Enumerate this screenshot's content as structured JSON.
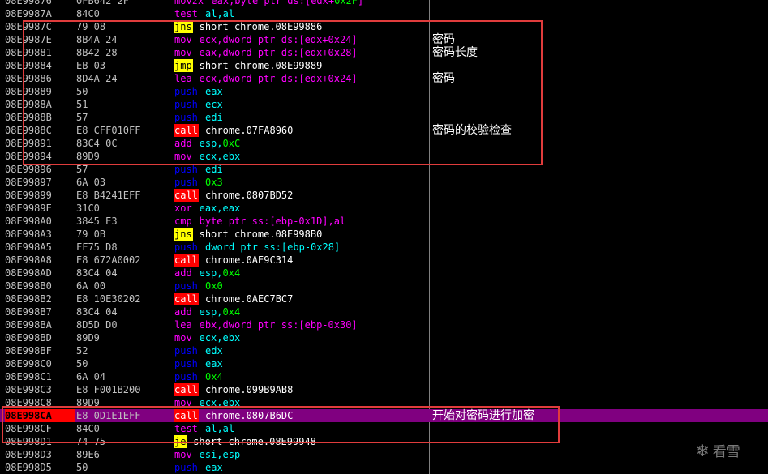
{
  "colors": {
    "background": "#000000",
    "text": "#c0c0c0",
    "selection": "#800080",
    "selected_address_bg": "#ff0000",
    "annotation_box": "#e03c3c",
    "mnemonic_call_bg": "#ff0000",
    "mnemonic_jump_bg": "#ffff00",
    "push_color": "#0000ff",
    "mov_color": "#ff00ff",
    "register_color": "#00ffff",
    "number_color": "#00ff00"
  },
  "rows": [
    {
      "addr": "08E99876",
      "bytes": "0FB642 2F",
      "mn": "movzx",
      "ops": [
        [
          "eax,byte ptr ds:[edx+",
          "mem"
        ],
        [
          "0x2F",
          "num"
        ],
        [
          "]",
          "mem"
        ]
      ],
      "mstyle": "mov"
    },
    {
      "addr": "08E9987A",
      "bytes": "84C0",
      "mn": "test",
      "ops": [
        [
          "al,al",
          "reg"
        ]
      ],
      "mstyle": "mov"
    },
    {
      "addr": "08E9987C",
      "bytes": "79 08",
      "mn": "jns",
      "ops": [
        [
          "short chrome.08E99886",
          "plain"
        ]
      ],
      "mstyle": "jmp"
    },
    {
      "addr": "08E9987E",
      "bytes": "8B4A 24",
      "mn": "mov",
      "ops": [
        [
          "ecx,dword ptr ds:[edx+0x24]",
          "mem"
        ]
      ],
      "mstyle": "mov",
      "comment": "密码"
    },
    {
      "addr": "08E99881",
      "bytes": "8B42 28",
      "mn": "mov",
      "ops": [
        [
          "eax,dword ptr ds:[edx+0x28]",
          "mem"
        ]
      ],
      "mstyle": "mov",
      "comment": "密码长度"
    },
    {
      "addr": "08E99884",
      "bytes": "EB 03",
      "mn": "jmp",
      "ops": [
        [
          "short chrome.08E99889",
          "plain"
        ]
      ],
      "mstyle": "jmp"
    },
    {
      "addr": "08E99886",
      "bytes": "8D4A 24",
      "mn": "lea",
      "ops": [
        [
          "ecx,dword ptr ds:[edx+0x24]",
          "mem"
        ]
      ],
      "mstyle": "mov",
      "comment": "密码"
    },
    {
      "addr": "08E99889",
      "bytes": "50",
      "mn": "push",
      "ops": [
        [
          "eax",
          "reg"
        ]
      ],
      "mstyle": "push"
    },
    {
      "addr": "08E9988A",
      "bytes": "51",
      "mn": "push",
      "ops": [
        [
          "ecx",
          "reg"
        ]
      ],
      "mstyle": "push"
    },
    {
      "addr": "08E9988B",
      "bytes": "57",
      "mn": "push",
      "ops": [
        [
          "edi",
          "reg"
        ]
      ],
      "mstyle": "push"
    },
    {
      "addr": "08E9988C",
      "bytes": "E8 CFF010FF",
      "mn": "call",
      "ops": [
        [
          "chrome.07FA8960",
          "plain"
        ]
      ],
      "mstyle": "call",
      "comment": "密码的校验检查"
    },
    {
      "addr": "08E99891",
      "bytes": "83C4 0C",
      "mn": "add",
      "ops": [
        [
          "esp,",
          "reg"
        ],
        [
          "0xC",
          "num"
        ]
      ],
      "mstyle": "mov"
    },
    {
      "addr": "08E99894",
      "bytes": "89D9",
      "mn": "mov",
      "ops": [
        [
          "ecx,ebx",
          "reg"
        ]
      ],
      "mstyle": "mov"
    },
    {
      "addr": "08E99896",
      "bytes": "57",
      "mn": "push",
      "ops": [
        [
          "edi",
          "reg"
        ]
      ],
      "mstyle": "push"
    },
    {
      "addr": "08E99897",
      "bytes": "6A 03",
      "mn": "push",
      "ops": [
        [
          "0x3",
          "num"
        ]
      ],
      "mstyle": "push"
    },
    {
      "addr": "08E99899",
      "bytes": "E8 B4241EFF",
      "mn": "call",
      "ops": [
        [
          "chrome.0807BD52",
          "plain"
        ]
      ],
      "mstyle": "call"
    },
    {
      "addr": "08E9989E",
      "bytes": "31C0",
      "mn": "xor",
      "ops": [
        [
          "eax,eax",
          "reg"
        ]
      ],
      "mstyle": "mov"
    },
    {
      "addr": "08E998A0",
      "bytes": "3845 E3",
      "mn": "cmp",
      "ops": [
        [
          "byte ptr ss:[ebp-0x1D],al",
          "mem"
        ]
      ],
      "mstyle": "mov"
    },
    {
      "addr": "08E998A3",
      "bytes": "79 0B",
      "mn": "jns",
      "ops": [
        [
          "short chrome.08E998B0",
          "plain"
        ]
      ],
      "mstyle": "jmp"
    },
    {
      "addr": "08E998A5",
      "bytes": "FF75 D8",
      "mn": "push",
      "ops": [
        [
          "dword ptr ss:[ebp-0x28]",
          "mem"
        ]
      ],
      "mstyle": "push"
    },
    {
      "addr": "08E998A8",
      "bytes": "E8 672A0002",
      "mn": "call",
      "ops": [
        [
          "chrome.0AE9C314",
          "plain"
        ]
      ],
      "mstyle": "call"
    },
    {
      "addr": "08E998AD",
      "bytes": "83C4 04",
      "mn": "add",
      "ops": [
        [
          "esp,",
          "reg"
        ],
        [
          "0x4",
          "num"
        ]
      ],
      "mstyle": "mov"
    },
    {
      "addr": "08E998B0",
      "bytes": "6A 00",
      "mn": "push",
      "ops": [
        [
          "0x0",
          "num"
        ]
      ],
      "mstyle": "push"
    },
    {
      "addr": "08E998B2",
      "bytes": "E8 10E30202",
      "mn": "call",
      "ops": [
        [
          "chrome.0AEC7BC7",
          "plain"
        ]
      ],
      "mstyle": "call"
    },
    {
      "addr": "08E998B7",
      "bytes": "83C4 04",
      "mn": "add",
      "ops": [
        [
          "esp,",
          "reg"
        ],
        [
          "0x4",
          "num"
        ]
      ],
      "mstyle": "mov"
    },
    {
      "addr": "08E998BA",
      "bytes": "8D5D D0",
      "mn": "lea",
      "ops": [
        [
          "ebx,dword ptr ss:[ebp-0x30]",
          "mem"
        ]
      ],
      "mstyle": "mov"
    },
    {
      "addr": "08E998BD",
      "bytes": "89D9",
      "mn": "mov",
      "ops": [
        [
          "ecx,ebx",
          "reg"
        ]
      ],
      "mstyle": "mov"
    },
    {
      "addr": "08E998BF",
      "bytes": "52",
      "mn": "push",
      "ops": [
        [
          "edx",
          "reg"
        ]
      ],
      "mstyle": "push"
    },
    {
      "addr": "08E998C0",
      "bytes": "50",
      "mn": "push",
      "ops": [
        [
          "eax",
          "reg"
        ]
      ],
      "mstyle": "push"
    },
    {
      "addr": "08E998C1",
      "bytes": "6A 04",
      "mn": "push",
      "ops": [
        [
          "0x4",
          "num"
        ]
      ],
      "mstyle": "push"
    },
    {
      "addr": "08E998C3",
      "bytes": "E8 F001B200",
      "mn": "call",
      "ops": [
        [
          "chrome.099B9AB8",
          "plain"
        ]
      ],
      "mstyle": "call"
    },
    {
      "addr": "08E998C8",
      "bytes": "89D9",
      "mn": "mov",
      "ops": [
        [
          "ecx,ebx",
          "reg"
        ]
      ],
      "mstyle": "mov"
    },
    {
      "addr": "08E998CA",
      "bytes": "E8 0D1E1EFF",
      "mn": "call",
      "ops": [
        [
          "chrome.0807B6DC",
          "plain"
        ]
      ],
      "mstyle": "call",
      "selected": true,
      "comment": "开始对密码进行加密"
    },
    {
      "addr": "08E998CF",
      "bytes": "84C0",
      "mn": "test",
      "ops": [
        [
          "al,al",
          "reg"
        ]
      ],
      "mstyle": "mov"
    },
    {
      "addr": "08E998D1",
      "bytes": "74 75",
      "mn": "je",
      "ops": [
        [
          "short chrome.08E99948",
          "plain"
        ]
      ],
      "mstyle": "jmp"
    },
    {
      "addr": "08E998D3",
      "bytes": "89E6",
      "mn": "mov",
      "ops": [
        [
          "esi,esp",
          "reg"
        ]
      ],
      "mstyle": "mov"
    },
    {
      "addr": "08E998D5",
      "bytes": "50",
      "mn": "push",
      "ops": [
        [
          "eax",
          "reg"
        ]
      ],
      "mstyle": "push"
    }
  ],
  "watermark": {
    "text": "看雪",
    "icon": "snowflake-icon"
  }
}
